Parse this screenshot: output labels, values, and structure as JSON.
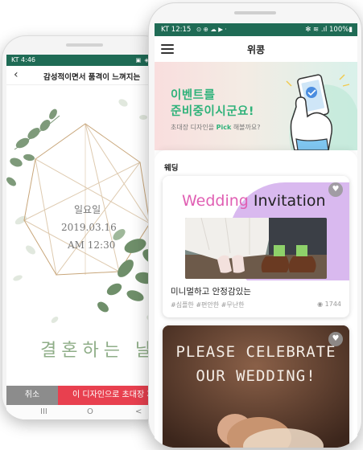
{
  "back_phone": {
    "status": {
      "carrier_time": "KT 4:46",
      "icons": "▣ ◈ ≋ ▮"
    },
    "header": {
      "back_icon": "chevron-left",
      "title": "감성적이면서 품격이 느껴지는"
    },
    "invitation": {
      "day": "일요일",
      "date": "2019.03.16",
      "time": "AM 12:30",
      "headline": "결혼하는 날"
    },
    "actions": {
      "cancel": "취소",
      "invite": "이 디자인으로 초대장 제"
    },
    "nav": {
      "recent": "III",
      "home": "O",
      "back": "<"
    }
  },
  "front_phone": {
    "status": {
      "carrier_time": "KT 12:15",
      "icons": "⊙ ⊕ ☁ ▶ ·",
      "right": "✻ ≋ .ıl 100%▮"
    },
    "header": {
      "menu_icon": "hamburger",
      "title": "위콩"
    },
    "banner": {
      "line1": "이벤트를",
      "line2": "준비중이시군요!",
      "sub_before": "초대장 디자인을 ",
      "sub_highlight": "Pick",
      "sub_after": " 해볼까요?"
    },
    "section": {
      "label": "웨딩"
    },
    "cards": [
      {
        "title_pink": "Wedding",
        "title_dark": " Invitation",
        "name": "미니멀하고 안정감있는",
        "tags": "#심플한 #편안한 #무난한",
        "views": "1744",
        "favorite_icon": "heart"
      },
      {
        "line1": "PLEASE CELEBRATE",
        "line2": "OUR WEDDING!",
        "favorite_icon": "heart"
      }
    ]
  },
  "colors": {
    "status_bar": "#1f6b55",
    "brand_green": "#2fb27a",
    "invite_red": "#e8404f",
    "cancel_gray": "#8c8c8c",
    "accent_pink": "#e05fb3",
    "accent_purple": "#d9b9ef",
    "card_brown": "#5b3a2c"
  }
}
